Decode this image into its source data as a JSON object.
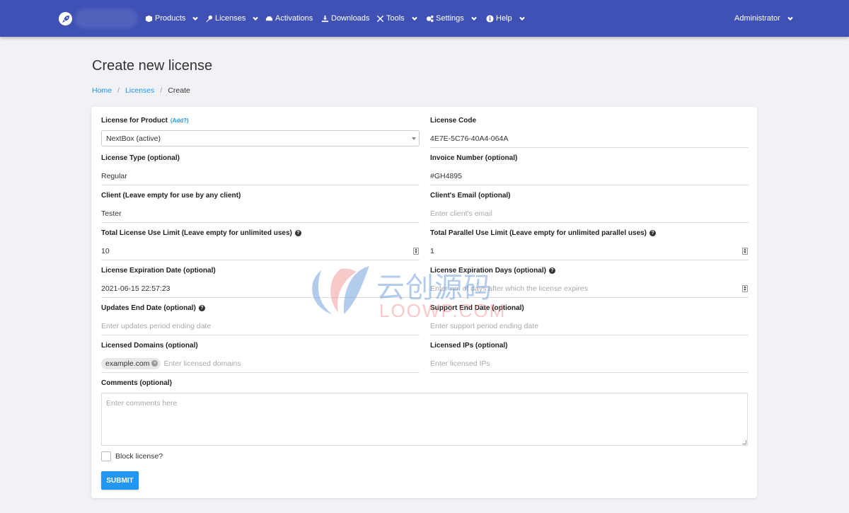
{
  "nav": {
    "items": [
      {
        "label": "Products",
        "icon": "box-icon",
        "dropdown": true
      },
      {
        "label": "Licenses",
        "icon": "key-icon",
        "dropdown": true
      },
      {
        "label": "Activations",
        "icon": "car-icon",
        "dropdown": false
      },
      {
        "label": "Downloads",
        "icon": "download-icon",
        "dropdown": false
      },
      {
        "label": "Tools",
        "icon": "tools-icon",
        "dropdown": true
      },
      {
        "label": "Settings",
        "icon": "cogs-icon",
        "dropdown": true
      },
      {
        "label": "Help",
        "icon": "info-icon",
        "dropdown": true
      }
    ],
    "user": "Administrator",
    "color": "#3f51b5"
  },
  "page": {
    "title": "Create new license",
    "breadcrumb": [
      "Home",
      "Licenses",
      "Create"
    ]
  },
  "form": {
    "product": {
      "label": "License for Product",
      "add": "(Add?)",
      "value": "NextBox (active)"
    },
    "code": {
      "label": "License Code",
      "value": "4E7E-5C76-40A4-064A"
    },
    "type": {
      "label": "License Type (optional)",
      "value": "Regular"
    },
    "invoice": {
      "label": "Invoice Number (optional)",
      "value": "#GH4895"
    },
    "client": {
      "label": "Client (Leave empty for use by any client)",
      "value": "Tester"
    },
    "email": {
      "label": "Client's Email (optional)",
      "placeholder": "Enter client's email"
    },
    "use_limit": {
      "label": "Total License Use Limit (Leave empty for unlimited uses)",
      "value": "10"
    },
    "parallel_limit": {
      "label": "Total Parallel Use Limit (Leave empty for unlimited parallel uses)",
      "value": "1"
    },
    "expiration_date": {
      "label": "License Expiration Date (optional)",
      "value": "2021-06-15 22:57:23"
    },
    "expiration_days": {
      "label": "License Expiration Days (optional)",
      "placeholder": "Enter no. of days after which the license expires"
    },
    "updates_end": {
      "label": "Updates End Date (optional)",
      "placeholder": "Enter updates period ending date"
    },
    "support_end": {
      "label": "Support End Date (optional)",
      "placeholder": "Enter support period ending date"
    },
    "domains": {
      "label": "Licensed Domains (optional)",
      "tags": [
        "example.com"
      ],
      "placeholder": "Enter licensed domains"
    },
    "ips": {
      "label": "Licensed IPs (optional)",
      "placeholder": "Enter licensed IPs"
    },
    "comments": {
      "label": "Comments (optional)",
      "placeholder": "Enter comments here"
    },
    "block": {
      "label": "Block license?"
    },
    "submit": "SUBMIT"
  },
  "watermark": {
    "cn": "云创源码",
    "en": "LOOWP.COM"
  },
  "colors": {
    "accent": "#2196f3",
    "background": "#f1f2f6"
  }
}
